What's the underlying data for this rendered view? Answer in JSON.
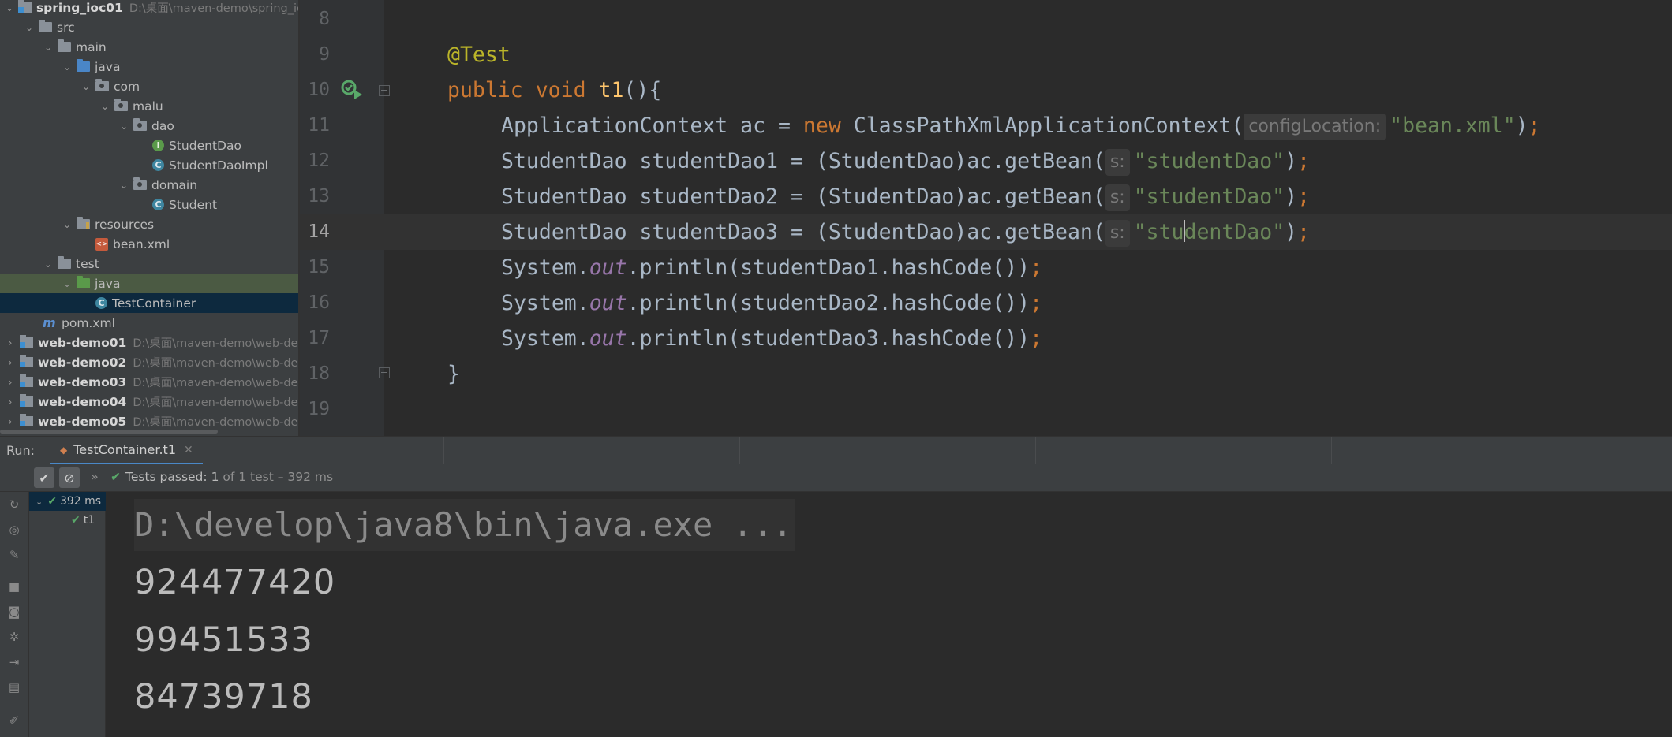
{
  "project_tree": {
    "items": [
      {
        "label": "spring_ioc01",
        "path": "D:\\桌面\\maven-demo\\spring_ic",
        "icon": "module-folder-icon",
        "chevron": "down",
        "bold": true
      },
      {
        "label": "src",
        "icon": "folder-icon",
        "chevron": "down"
      },
      {
        "label": "main",
        "icon": "folder-icon",
        "chevron": "down"
      },
      {
        "label": "java",
        "icon": "source-folder-icon",
        "chevron": "down"
      },
      {
        "label": "com",
        "icon": "package-icon",
        "chevron": "down"
      },
      {
        "label": "malu",
        "icon": "package-icon",
        "chevron": "down"
      },
      {
        "label": "dao",
        "icon": "package-icon",
        "chevron": "down"
      },
      {
        "label": "StudentDao",
        "icon": "interface-icon"
      },
      {
        "label": "StudentDaoImpl",
        "icon": "class-icon"
      },
      {
        "label": "domain",
        "icon": "package-icon",
        "chevron": "down"
      },
      {
        "label": "Student",
        "icon": "class-icon"
      },
      {
        "label": "resources",
        "icon": "resources-folder-icon",
        "chevron": "down"
      },
      {
        "label": "bean.xml",
        "icon": "xml-file-icon"
      },
      {
        "label": "test",
        "icon": "folder-icon",
        "chevron": "down"
      },
      {
        "label": "java",
        "icon": "test-source-folder-icon",
        "chevron": "down"
      },
      {
        "label": "TestContainer",
        "icon": "class-icon"
      },
      {
        "label": "pom.xml",
        "icon": "maven-icon"
      },
      {
        "label": "web-demo01",
        "path": "D:\\桌面\\maven-demo\\web-de",
        "icon": "module-folder-icon",
        "chevron": "right",
        "bold": true
      },
      {
        "label": "web-demo02",
        "path": "D:\\桌面\\maven-demo\\web-de",
        "icon": "module-folder-icon",
        "chevron": "right",
        "bold": true
      },
      {
        "label": "web-demo03",
        "path": "D:\\桌面\\maven-demo\\web-de",
        "icon": "module-folder-icon",
        "chevron": "right",
        "bold": true
      },
      {
        "label": "web-demo04",
        "path": "D:\\桌面\\maven-demo\\web-de",
        "icon": "module-folder-icon",
        "chevron": "right",
        "bold": true
      },
      {
        "label": "web-demo05",
        "path": "D:\\桌面\\maven-demo\\web-de",
        "icon": "module-folder-icon",
        "chevron": "right",
        "bold": true
      }
    ]
  },
  "editor": {
    "current_line": "14",
    "lines": [
      {
        "num": "8"
      },
      {
        "num": "9",
        "t1": "@Test"
      },
      {
        "num": "10",
        "t1": "public",
        "t2": "void",
        "t3": "t1",
        "t4": "(){"
      },
      {
        "num": "11",
        "a": "ApplicationContext ac = ",
        "kw": "new",
        "b": " ClassPathXmlApplicationContext(",
        "hint": "configLocation:",
        "str": "\"bean.xml\"",
        "c": ")",
        "semi": ";"
      },
      {
        "num": "12",
        "a": "StudentDao studentDao1 = (StudentDao)ac.getBean(",
        "hint": "s:",
        "str": "\"studentDao\"",
        "c": ")",
        "semi": ";"
      },
      {
        "num": "13",
        "a": "StudentDao studentDao2 = (StudentDao)ac.getBean(",
        "hint": "s:",
        "str": "\"studentDao\"",
        "c": ")",
        "semi": ";"
      },
      {
        "num": "14",
        "a": "StudentDao studentDao3 = (StudentDao)ac.getBean(",
        "hint": "s:",
        "str_pre": "\"stu",
        "str_post": "dentDao\"",
        "c": ")",
        "semi": ";"
      },
      {
        "num": "15",
        "a": "System.",
        "fld": "out",
        "b": ".println(studentDao1.hashCode())",
        "semi": ";"
      },
      {
        "num": "16",
        "a": "System.",
        "fld": "out",
        "b": ".println(studentDao2.hashCode())",
        "semi": ";"
      },
      {
        "num": "17",
        "a": "System.",
        "fld": "out",
        "b": ".println(studentDao3.hashCode())",
        "semi": ";"
      },
      {
        "num": "18",
        "a": "}"
      },
      {
        "num": "19"
      }
    ]
  },
  "run_window": {
    "label": "Run:",
    "tab": "TestContainer.t1",
    "status_prefix": "Tests passed:",
    "status_count": "1",
    "status_rest": "of 1 test – 392 ms",
    "test_tree": [
      {
        "label": "392 ms"
      },
      {
        "label": "t1"
      }
    ],
    "console": [
      "D:\\develop\\java8\\bin\\java.exe ...",
      "924477420",
      "99451533",
      "84739718"
    ]
  },
  "colors": {
    "accent": "#4a88c7",
    "pass": "#59a869",
    "keyword": "#cc7832",
    "string": "#6a8759",
    "annotation": "#bbb529",
    "method": "#ffc66d"
  }
}
